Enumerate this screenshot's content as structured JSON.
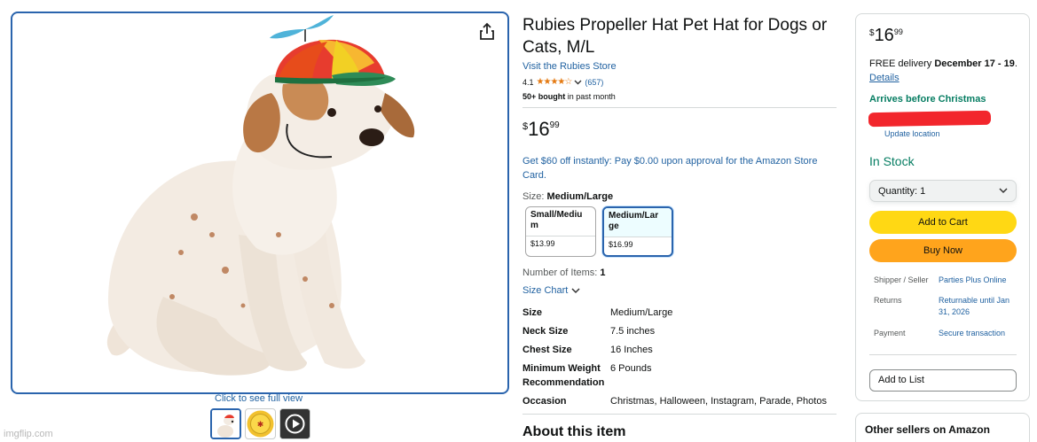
{
  "gallery": {
    "full_view_label": "Click to see full view",
    "thumbnails": [
      "dog-thumbnail",
      "badge-thumbnail",
      "video-thumbnail"
    ],
    "watermark": "imgflip.com"
  },
  "product": {
    "title": "Rubies Propeller Hat Pet Hat for Dogs or Cats, M/L",
    "store_link": "Visit the Rubies Store",
    "rating": "4.1",
    "stars": "★★★★☆",
    "rating_count": "(657)",
    "bought_bold": "50+ bought",
    "bought_rest": " in past month",
    "price": {
      "currency": "$",
      "whole": "16",
      "fraction": "99"
    },
    "promo": "Get $60 off instantly: Pay $0.00 upon approval for the Amazon Store Card.",
    "size_label": "Size: ",
    "size_selected": "Medium/Large",
    "size_options": [
      {
        "name": "Small/Mediu m",
        "price": "$13.99"
      },
      {
        "name": "Medium/Lar ge",
        "price": "$16.99"
      }
    ],
    "items_label": "Number of Items: ",
    "items_value": "1",
    "size_chart": "Size Chart",
    "specs": [
      {
        "key": "Size",
        "value": "Medium/Large"
      },
      {
        "key": "Neck Size",
        "value": "7.5 inches"
      },
      {
        "key": "Chest Size",
        "value": "16 Inches"
      },
      {
        "key": "Minimum Weight Recommendation",
        "value": "6 Pounds"
      },
      {
        "key": "Occasion",
        "value": "Christmas, Halloween, Instagram, Parade, Photos"
      }
    ],
    "about": "About this item"
  },
  "buybox": {
    "price": {
      "currency": "$",
      "whole": "16",
      "fraction": "99"
    },
    "delivery_pre": "FREE delivery ",
    "delivery_date": "December 17 - 19",
    "delivery_dot": ". ",
    "details_link": "Details",
    "arrives": "Arrives before Christmas",
    "update_location": "Update location",
    "stock": "In Stock",
    "quantity": "Quantity: 1",
    "add_to_cart": "Add to Cart",
    "buy_now": "Buy Now",
    "shipper_label": "Shipper / Seller",
    "shipper_value": "Parties Plus Online",
    "returns_label": "Returns",
    "returns_value": "Returnable until Jan 31, 2026",
    "payment_label": "Payment",
    "payment_value": "Secure transaction",
    "add_to_list": "Add to List",
    "other_sellers": "Other sellers on Amazon"
  },
  "colors": {
    "link": "#2162a1",
    "stock_green": "#067d62",
    "cart_yellow": "#ffd814",
    "buy_orange": "#ffa41c",
    "star_orange": "#e47911",
    "selected_border": "#2a64ad"
  }
}
